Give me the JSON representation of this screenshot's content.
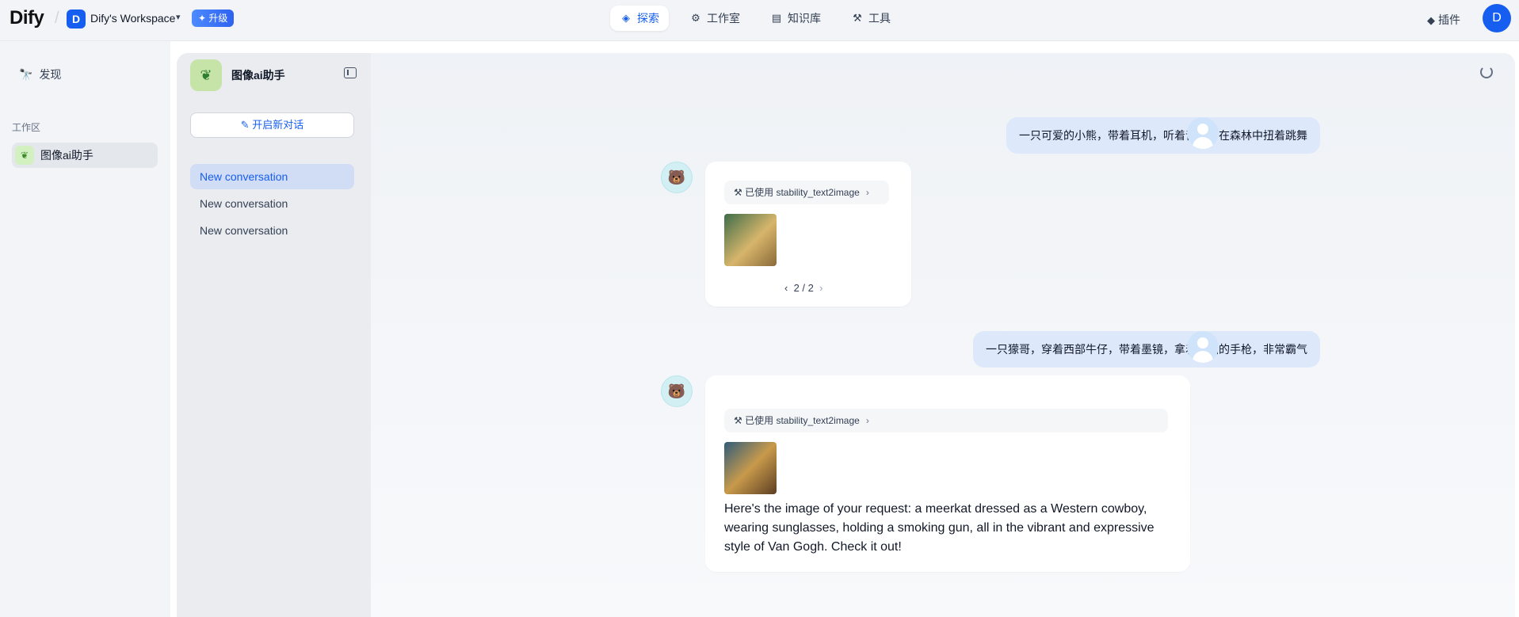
{
  "header": {
    "logo": "Dify",
    "workspace_initial": "D",
    "workspace_name": "Dify's Workspace",
    "upgrade_label": "升级",
    "nav": [
      {
        "label": "探索",
        "icon": "compass-icon"
      },
      {
        "label": "工作室",
        "icon": "robot-icon"
      },
      {
        "label": "知识库",
        "icon": "book-icon"
      },
      {
        "label": "工具",
        "icon": "hammer-icon"
      }
    ],
    "plugins_label": "插件",
    "user_initial": "D"
  },
  "sidebar": {
    "discover_label": "发现",
    "workspace_section_label": "工作区",
    "apps": [
      {
        "label": "图像ai助手"
      }
    ]
  },
  "conversation_panel": {
    "app_title": "图像ai助手",
    "new_chat_label": "开启新对话",
    "conversations": [
      {
        "label": "New conversation",
        "active": true
      },
      {
        "label": "New conversation",
        "active": false
      },
      {
        "label": "New conversation",
        "active": false
      }
    ]
  },
  "chat": {
    "messages": [
      {
        "role": "user",
        "text": "一只可爱的小熊，带着耳机，听着音乐，在森林中扭着跳舞"
      },
      {
        "role": "assistant",
        "tool_label": "已使用 stability_text2image",
        "pager": "2 / 2"
      },
      {
        "role": "user",
        "text": "一只獴哥，穿着西部牛仔，带着墨镜，拿着冒烟的手枪，非常霸气"
      },
      {
        "role": "assistant",
        "tool_label": "已使用 stability_text2image",
        "answer": "Here's the image of your request: a meerkat dressed as a Western cowboy, wearing sunglasses, holding a smoking gun, all in the vibrant and expressive style of Van Gogh. Check it out!"
      }
    ]
  },
  "colors": {
    "accent": "#155eef",
    "user_bubble": "#dde8fb",
    "panel_bg": "#eaecf0"
  }
}
